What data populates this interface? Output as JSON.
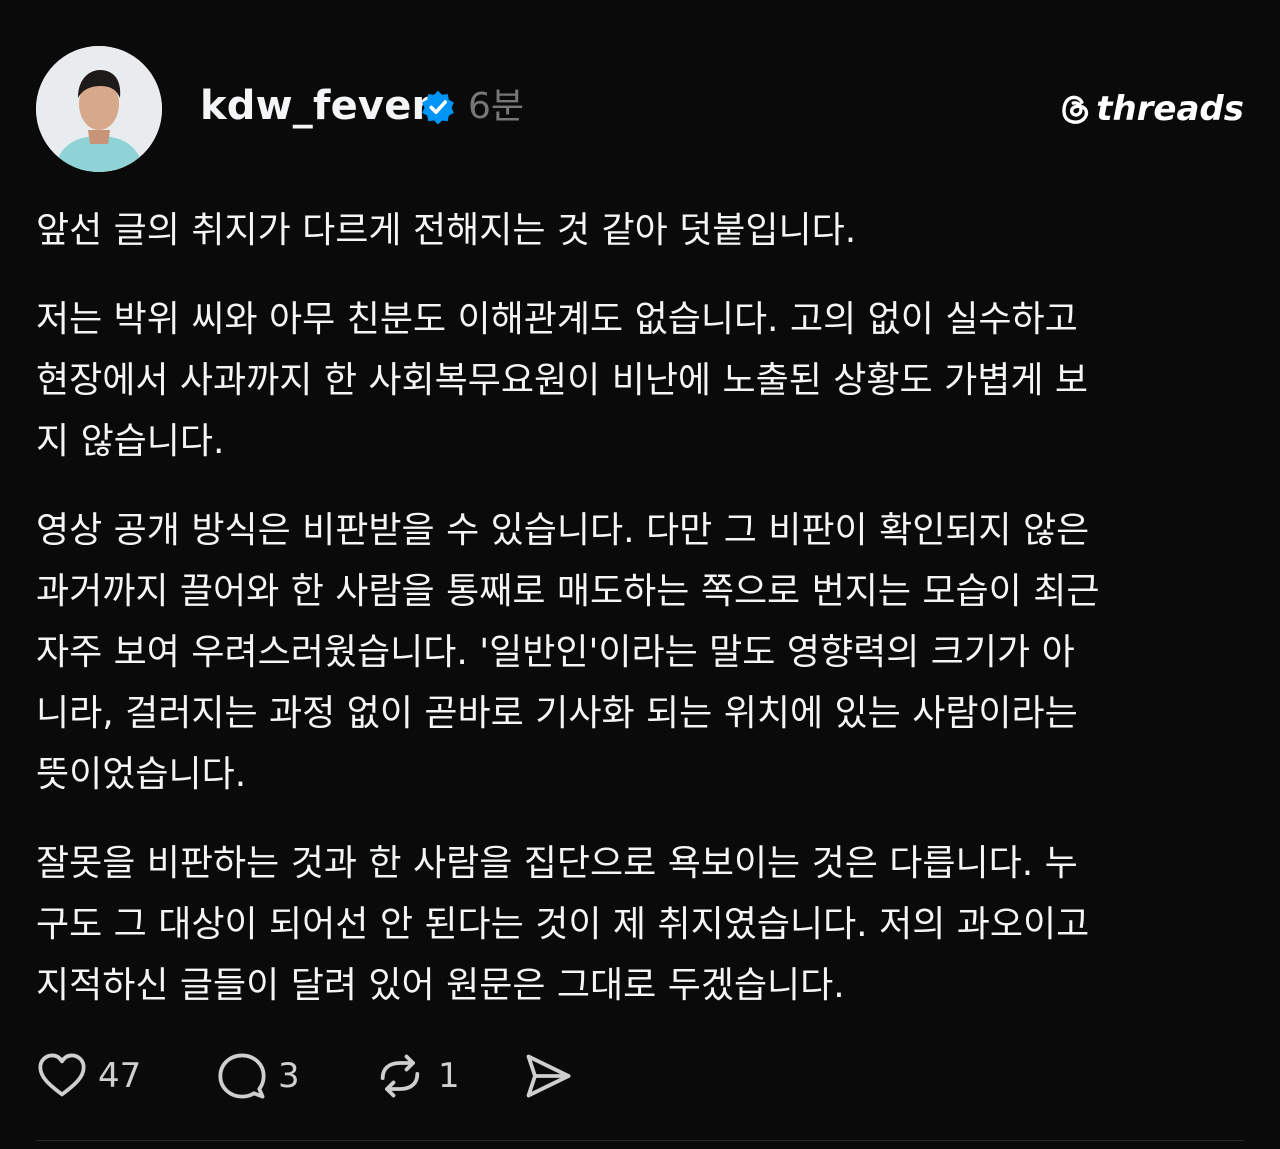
{
  "post": {
    "username": "kdw_fever",
    "timestamp": "6분",
    "brand": "threads",
    "paragraphs": [
      "앞선 글의 취지가 다르게 전해지는 것 같아 덧붙입니다.",
      "저는 박위 씨와 아무 친분도 이해관계도 없습니다. 고의 없이 실수하고\n현장에서 사과까지 한 사회복무요원이 비난에 노출된 상황도 가볍게 보\n지 않습니다.",
      "영상 공개 방식은 비판받을 수 있습니다. 다만 그 비판이 확인되지 않은\n과거까지 끌어와 한 사람을 통째로 매도하는 쪽으로 번지는 모습이 최근\n자주 보여 우려스러웠습니다. '일반인'이라는 말도 영향력의 크기가 아\n니라, 걸러지는 과정 없이 곧바로 기사화 되는 위치에 있는 사람이라는\n뜻이었습니다.",
      "잘못을 비판하는 것과 한 사람을 집단으로 욕보이는 것은 다릅니다. 누\n구도 그 대상이 되어선 안 된다는 것이 제 취지였습니다. 저의 과오이고\n지적하신 글들이 달려 있어 원문은 그대로 두겠습니다."
    ],
    "stats": {
      "likes": "47",
      "replies": "3",
      "reposts": "1"
    }
  },
  "icons": {
    "verified": "verified-badge-icon",
    "brand": "threads-logo-icon",
    "like": "heart-icon",
    "reply": "comment-icon",
    "repost": "repost-icon",
    "share": "send-icon"
  },
  "colors": {
    "background": "#0a0a0a",
    "text": "#f3f5f7",
    "muted": "#777777",
    "verified": "#0095f6"
  }
}
